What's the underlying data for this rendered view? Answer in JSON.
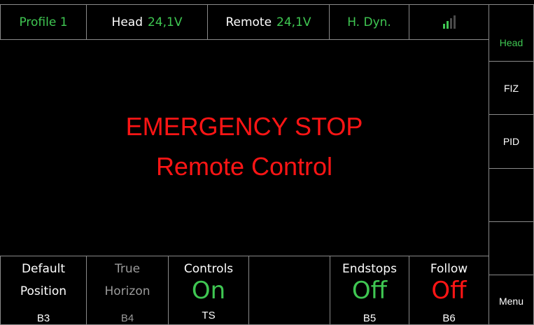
{
  "status_bar": {
    "profile": "Profile 1",
    "head_label": "Head",
    "head_voltage": "24,1V",
    "remote_label": "Remote",
    "remote_voltage": "24,1V",
    "mode": "H. Dyn.",
    "signal_bars_active": 2,
    "signal_bars_total": 4
  },
  "message": {
    "line1": "EMERGENCY STOP",
    "line2": "Remote Control"
  },
  "side_menu": {
    "head": "Head",
    "fiz": "FIZ",
    "pid": "PID",
    "menu": "Menu"
  },
  "buttons": {
    "default_position": {
      "line1": "Default",
      "line2": "Position",
      "key": "B3"
    },
    "true_horizon": {
      "line1": "True",
      "line2": "Horizon",
      "key": "B4"
    },
    "controls": {
      "title": "Controls",
      "value": "On",
      "key": "TS"
    },
    "endstops": {
      "title": "Endstops",
      "value": "Off",
      "key": "B5"
    },
    "follow": {
      "title": "Follow",
      "value": "Off",
      "key": "B6"
    }
  },
  "colors": {
    "ok": "#3fc752",
    "alert": "#ff1515",
    "border": "#8a8a8a",
    "disabled": "#9a9a9a"
  }
}
